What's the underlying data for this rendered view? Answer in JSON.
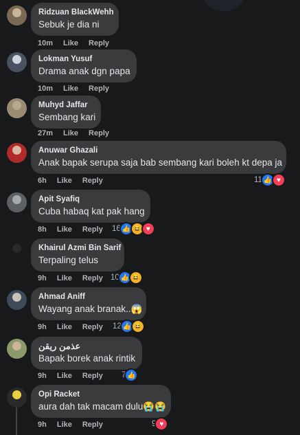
{
  "comments": [
    {
      "name": "Ridzuan BlackWehh",
      "text": "Sebuk je dia ni",
      "time": "10m",
      "like": "Like",
      "reply": "Reply",
      "reaction_count": "",
      "reactions": [],
      "avatar_color": "#c9b59a",
      "avatar_shirt": "#7a6a55"
    },
    {
      "name": "Lokman Yusuf",
      "text": "Drama anak dgn papa",
      "time": "10m",
      "like": "Like",
      "reply": "Reply",
      "reaction_count": "",
      "reactions": [],
      "avatar_color": "#cfd4dc",
      "avatar_shirt": "#4a5262"
    },
    {
      "name": "Muhyd Jaffar",
      "text": "Sembang kari",
      "time": "27m",
      "like": "Like",
      "reply": "Reply",
      "reaction_count": "",
      "reactions": [],
      "avatar_color": "#b8a98e",
      "avatar_shirt": "#9a8b73"
    },
    {
      "name": "Anuwar Ghazali",
      "text": "Anak bapak serupa saja bab sembang kari boleh kt depa ja",
      "time": "6h",
      "like": "Like",
      "reply": "Reply",
      "reaction_count": "11",
      "reactions": [
        "like",
        "love"
      ],
      "avatar_color": "#d8b8a0",
      "avatar_shirt": "#b02a2a"
    },
    {
      "name": "Apit Syafiq",
      "text": "Cuba habaq kat pak hang",
      "time": "8h",
      "like": "Like",
      "reply": "Reply",
      "reaction_count": "16",
      "reactions": [
        "like",
        "haha",
        "love"
      ],
      "avatar_color": "#a6a8ab",
      "avatar_shirt": "#5c5f63"
    },
    {
      "name": "Khairul Azmi Bin Sarif",
      "text": "Terpaling telus",
      "time": "9h",
      "like": "Like",
      "reply": "Reply",
      "reaction_count": "10",
      "reactions": [
        "like",
        "haha"
      ],
      "avatar_color": "#2a2a2a",
      "avatar_shirt": "#1a1a1a"
    },
    {
      "name": "Ahmad Aniff",
      "text": "Wayang anak branak..😱",
      "time": "9h",
      "like": "Like",
      "reply": "Reply",
      "reaction_count": "12",
      "reactions": [
        "like",
        "haha"
      ],
      "avatar_color": "#c8c2b8",
      "avatar_shirt": "#3d4a5a"
    },
    {
      "name": "عذمن ريقن",
      "text": "Bapak borek anak rintik",
      "time": "9h",
      "like": "Like",
      "reply": "Reply",
      "reaction_count": "7",
      "reactions": [
        "like"
      ],
      "avatar_color": "#d0b49a",
      "avatar_shirt": "#8a9a6a"
    },
    {
      "name": "Opi Racket",
      "text": "aura dah tak macam dulu😭😭",
      "time": "9h",
      "like": "Like",
      "reply": "Reply",
      "reaction_count": "9",
      "reactions": [
        "love"
      ],
      "avatar_color": "#e8d040",
      "avatar_shirt": "#2a2a2a"
    }
  ],
  "reaction_glyphs": {
    "like": "👍",
    "love": "♥",
    "haha": "😆",
    "wow": "😮",
    "sad": "😢"
  }
}
